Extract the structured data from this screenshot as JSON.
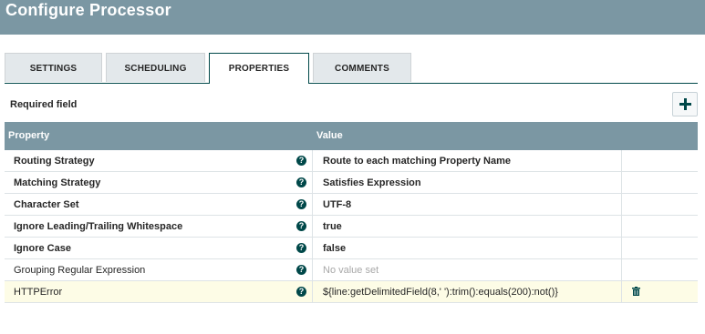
{
  "dialog": {
    "title": "Configure Processor"
  },
  "tabs": [
    {
      "label": "SETTINGS"
    },
    {
      "label": "SCHEDULING"
    },
    {
      "label": "PROPERTIES"
    },
    {
      "label": "COMMENTS"
    }
  ],
  "active_tab": "PROPERTIES",
  "required_label": "Required field",
  "table": {
    "headers": {
      "property": "Property",
      "value": "Value"
    },
    "rows": [
      {
        "name": "Routing Strategy",
        "value": "Route to each matching Property Name"
      },
      {
        "name": "Matching Strategy",
        "value": "Satisfies Expression"
      },
      {
        "name": "Character Set",
        "value": "UTF-8"
      },
      {
        "name": "Ignore Leading/Trailing Whitespace",
        "value": "true"
      },
      {
        "name": "Ignore Case",
        "value": "false"
      },
      {
        "name": "Grouping Regular Expression",
        "value": "No value set"
      },
      {
        "name": "HTTPError",
        "value": "${line:getDelimitedField(8,' '):trim():equals(200):not()}"
      }
    ]
  },
  "icons": {
    "help": "question-circle-icon",
    "add": "plus-icon",
    "delete": "trash-icon"
  },
  "colors": {
    "header_bg": "#7b97a3",
    "accent": "#004849",
    "highlight_row": "#fdfce6"
  }
}
